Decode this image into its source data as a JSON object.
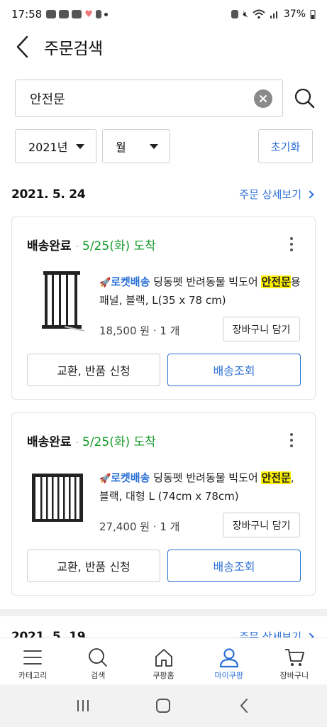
{
  "status_bar": {
    "time": "17:58",
    "battery": "37%"
  },
  "header": {
    "title": "주문검색"
  },
  "search": {
    "value": "안전문"
  },
  "filters": {
    "year": "2021년",
    "month": "월",
    "reset_label": "초기화"
  },
  "orders": [
    {
      "date": "2021. 5. 24",
      "detail_label": "주문 상세보기",
      "items": [
        {
          "status": "배송완료",
          "arrival": "5/25(화) 도착",
          "rocket_label": "로켓배송",
          "title_pre": "딩동펫 반려동물 빅도어 ",
          "title_highlight_1": "안전",
          "title_highlight_2": "문",
          "title_post": "용 패널, 블랙, L(35 x 78 cm)",
          "price": "18,500 원 · 1 개",
          "cart_label": "장바구니 담기",
          "exchange_label": "교환, 반품 신청",
          "track_label": "배송조회"
        },
        {
          "status": "배송완료",
          "arrival": "5/25(화) 도착",
          "rocket_label": "로켓배송",
          "title_pre": "딩동펫 반려동물 빅도어 ",
          "title_highlight_1": "안전",
          "title_highlight_2": "문",
          "title_post": ", 블랙, 대형 L (74cm x 78cm)",
          "price": "27,400 원 · 1 개",
          "cart_label": "장바구니 담기",
          "exchange_label": "교환, 반품 신청",
          "track_label": "배송조회"
        }
      ]
    },
    {
      "date": "2021. 5. 19",
      "detail_label": "주문 상세보기"
    }
  ],
  "bottom_nav": [
    {
      "label": "카테고리",
      "icon": "menu-icon"
    },
    {
      "label": "검색",
      "icon": "search-icon"
    },
    {
      "label": "쿠팡홈",
      "icon": "home-icon"
    },
    {
      "label": "마이쿠팡",
      "icon": "person-icon",
      "active": true
    },
    {
      "label": "장바구니",
      "icon": "cart-icon"
    }
  ],
  "colors": {
    "accent": "#2a6fd6",
    "arrival_green": "#159a2b",
    "highlight": "#fff200"
  }
}
